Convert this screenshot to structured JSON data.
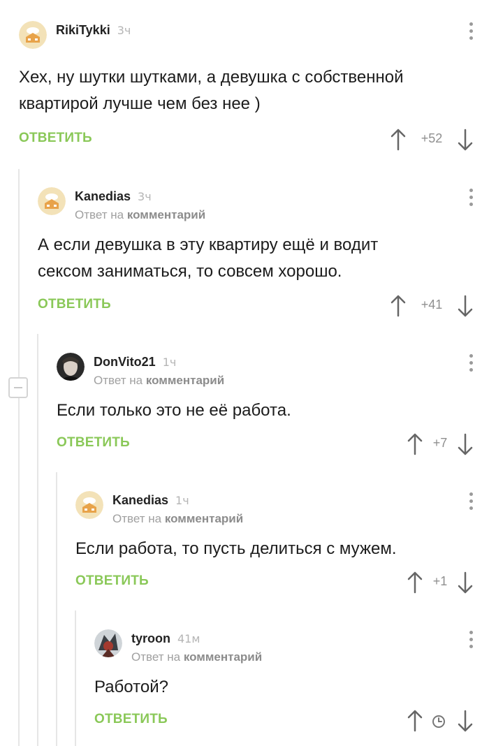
{
  "comments": [
    {
      "author": "RikiTykki",
      "time": "3ч",
      "reply_prefix": "",
      "reply_link": "",
      "text": "Хех, ну шутки шутками, а девушка с собственной квартирой лучше чем без нее )",
      "reply_label": "ОТВЕТИТЬ",
      "score": "+52"
    },
    {
      "author": "Kanedias",
      "time": "3ч",
      "reply_prefix": "Ответ на",
      "reply_link": "комментарий",
      "text": "А если девушка в эту квартиру ещё и водит сексом заниматься, то совсем хорошо.",
      "reply_label": "ОТВЕТИТЬ",
      "score": "+41"
    },
    {
      "author": "DonVito21",
      "time": "1ч",
      "reply_prefix": "Ответ на",
      "reply_link": "комментарий",
      "text": "Если только это не её работа.",
      "reply_label": "ОТВЕТИТЬ",
      "score": "+7"
    },
    {
      "author": "Kanedias",
      "time": "1ч",
      "reply_prefix": "Ответ на",
      "reply_link": "комментарий",
      "text": "Если работа, то пусть делиться с мужем.",
      "reply_label": "ОТВЕТИТЬ",
      "score": "+1"
    },
    {
      "author": "tyroon",
      "time": "41м",
      "reply_prefix": "Ответ на",
      "reply_link": "комментарий",
      "text": "Работой?",
      "reply_label": "ОТВЕТИТЬ",
      "score": ""
    }
  ],
  "icons": {
    "up": "arrow-up-icon",
    "down": "arrow-down-icon",
    "menu": "more-vertical-icon",
    "pending": "clock-icon",
    "collapse": "minus-icon"
  },
  "colors": {
    "reply_button": "#8ac858",
    "thread_line": "#e6e6e6",
    "muted_text": "#a0a0a0"
  }
}
